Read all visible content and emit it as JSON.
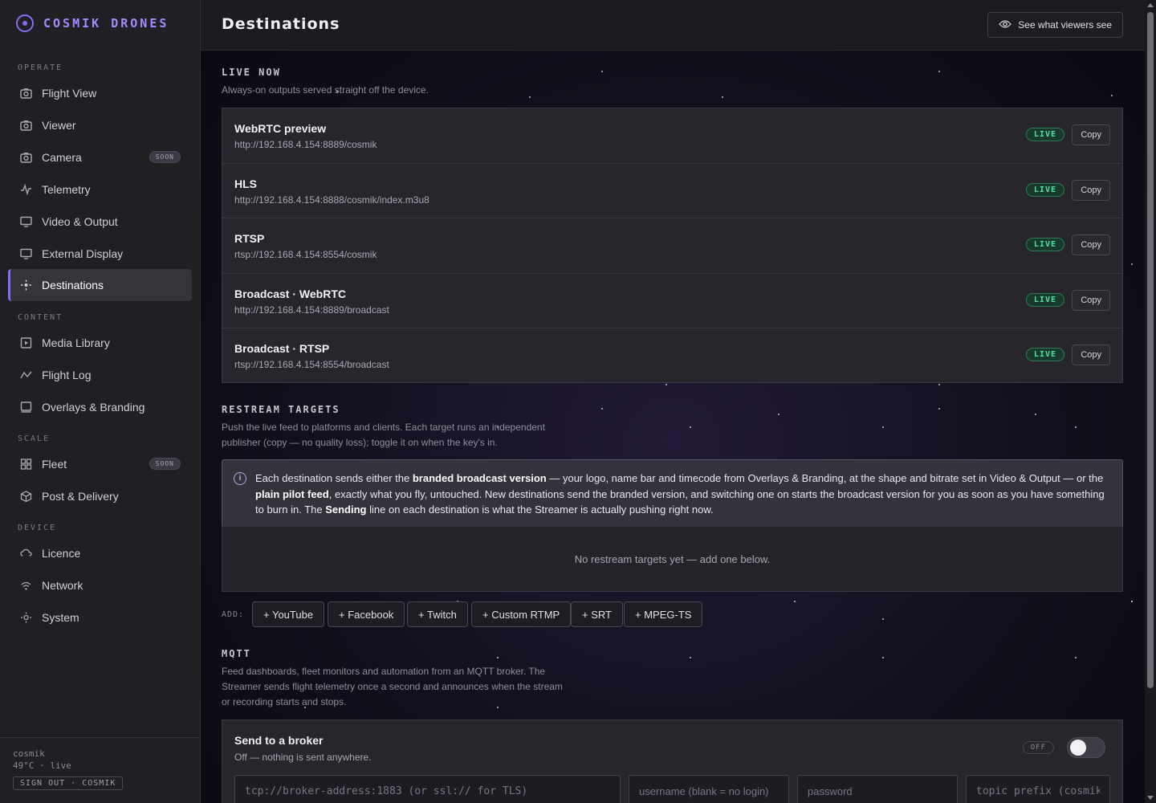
{
  "brand": {
    "name": "COSMIK DRONES",
    "logo_icon": "orbit-logo-icon",
    "accent": "#8b6cf0"
  },
  "sidebar": {
    "sections": [
      {
        "label": "OPERATE"
      },
      {
        "label": "CONTENT"
      },
      {
        "label": "SCALE"
      },
      {
        "label": "DEVICE"
      }
    ],
    "items": [
      {
        "label": "Flight View",
        "icon": "camera-icon"
      },
      {
        "label": "Viewer",
        "icon": "camera-icon"
      },
      {
        "label": "Camera",
        "icon": "camera-icon",
        "badge": "SOON"
      },
      {
        "label": "Telemetry",
        "icon": "activity-icon"
      },
      {
        "label": "Video & Output",
        "icon": "monitor-icon"
      },
      {
        "label": "External Display",
        "icon": "monitor-icon"
      },
      {
        "label": "Destinations",
        "icon": "broadcast-icon",
        "active": true
      },
      {
        "label": "Media Library",
        "icon": "play-square-icon"
      },
      {
        "label": "Flight Log",
        "icon": "chart-line-icon"
      },
      {
        "label": "Overlays & Branding",
        "icon": "layout-icon"
      },
      {
        "label": "Fleet",
        "icon": "grid-icon",
        "badge": "SOON"
      },
      {
        "label": "Post & Delivery",
        "icon": "box-icon"
      },
      {
        "label": "Licence",
        "icon": "cloud-icon"
      },
      {
        "label": "Network",
        "icon": "wifi-icon"
      },
      {
        "label": "System",
        "icon": "settings-icon"
      }
    ],
    "footer": {
      "user": "cosmik",
      "status": "49°C · live",
      "signout": "SIGN OUT · COSMIK"
    }
  },
  "header": {
    "title": "Destinations",
    "viewers_button": "See what viewers see",
    "viewers_icon": "eye-icon"
  },
  "live_now": {
    "title": "LIVE NOW",
    "description": "Always-on outputs served straight off the device.",
    "rows": [
      {
        "name": "WebRTC preview",
        "url": "http://192.168.4.154:8889/cosmik",
        "status": "LIVE",
        "action": "Copy"
      },
      {
        "name": "HLS",
        "url": "http://192.168.4.154:8888/cosmik/index.m3u8",
        "status": "LIVE",
        "action": "Copy"
      },
      {
        "name": "RTSP",
        "url": "rtsp://192.168.4.154:8554/cosmik",
        "status": "LIVE",
        "action": "Copy"
      },
      {
        "name": "Broadcast · WebRTC",
        "url": "http://192.168.4.154:8889/broadcast",
        "status": "LIVE",
        "action": "Copy"
      },
      {
        "name": "Broadcast · RTSP",
        "url": "rtsp://192.168.4.154:8554/broadcast",
        "status": "LIVE",
        "action": "Copy"
      }
    ]
  },
  "restream": {
    "title": "RESTREAM TARGETS",
    "description": "Push the live feed to platforms and clients. Each target runs an independent publisher (copy — no quality loss); toggle it on when the key's in.",
    "info": {
      "t1": "Each destination sends either the ",
      "b1": "branded broadcast version",
      "t2": " — your logo, name bar and timecode from Overlays & Branding, at the shape and bitrate set in Video & Output — or the ",
      "b2": "plain pilot feed",
      "t3": ", exactly what you fly, untouched. New destinations send the branded version, and switching one on starts the broadcast version for you as soon as you have something to burn in. The ",
      "b3": "Sending",
      "t4": " line on each destination is what the Streamer is actually pushing right now."
    },
    "empty": "No restream targets yet — add one below.",
    "add_label": "ADD:",
    "add_buttons": [
      "+ YouTube",
      "+ Facebook",
      "+ Twitch",
      "+ Custom RTMP",
      "+ SRT",
      "+ MPEG-TS"
    ]
  },
  "mqtt": {
    "title": "MQTT",
    "description": "Feed dashboards, fleet monitors and automation from an MQTT broker. The Streamer sends flight telemetry once a second and announces when the stream or recording starts and stops.",
    "broker": {
      "title": "Send to a broker",
      "subtitle": "Off — nothing is sent anywhere.",
      "state": "OFF",
      "address_placeholder": "tcp://broker-address:1883 (or ssl:// for TLS)",
      "username_placeholder": "username (blank = no login)",
      "password_placeholder": "password",
      "topic_placeholder": "topic prefix (cosmik)"
    }
  }
}
